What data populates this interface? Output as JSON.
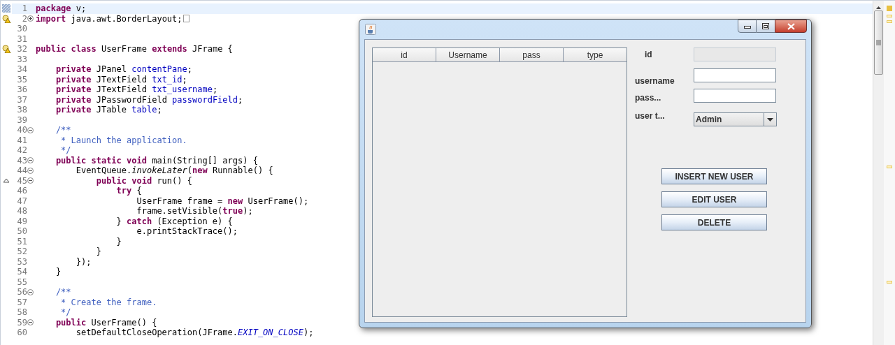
{
  "editor": {
    "lines": [
      {
        "number": "1",
        "current": true,
        "segments": [
          {
            "kind": "keyword",
            "text": "package"
          },
          {
            "kind": "plain",
            "text": " v;"
          }
        ]
      },
      {
        "number": "2",
        "warning": true,
        "fold_open": false,
        "folded_box": true,
        "segments": [
          {
            "kind": "keyword",
            "text": "import"
          },
          {
            "kind": "plain",
            "text": " java.awt.BorderLayout;"
          }
        ]
      },
      {
        "number": "30"
      },
      {
        "number": "31"
      },
      {
        "number": "32",
        "warning": true,
        "segments": [
          {
            "kind": "keyword",
            "text": "public"
          },
          {
            "kind": "keyword",
            "text": " class"
          },
          {
            "kind": "plain",
            "text": " UserFrame "
          },
          {
            "kind": "keyword",
            "text": "extends"
          },
          {
            "kind": "plain",
            "text": " JFrame {"
          }
        ]
      },
      {
        "number": "33"
      },
      {
        "number": "34",
        "segments": [
          {
            "kind": "keyword",
            "text": "    private"
          },
          {
            "kind": "plain",
            "text": " JPanel "
          },
          {
            "kind": "field",
            "text": "contentPane"
          },
          {
            "kind": "plain",
            "text": ";"
          }
        ]
      },
      {
        "number": "35",
        "segments": [
          {
            "kind": "keyword",
            "text": "    private"
          },
          {
            "kind": "plain",
            "text": " JTextField "
          },
          {
            "kind": "field",
            "text": "txt_id"
          },
          {
            "kind": "plain",
            "text": ";"
          }
        ]
      },
      {
        "number": "36",
        "segments": [
          {
            "kind": "keyword",
            "text": "    private"
          },
          {
            "kind": "plain",
            "text": " JTextField "
          },
          {
            "kind": "field",
            "text": "txt_username"
          },
          {
            "kind": "plain",
            "text": ";"
          }
        ]
      },
      {
        "number": "37",
        "segments": [
          {
            "kind": "keyword",
            "text": "    private"
          },
          {
            "kind": "plain",
            "text": " JPasswordField "
          },
          {
            "kind": "field",
            "text": "passwordField"
          },
          {
            "kind": "plain",
            "text": ";"
          }
        ]
      },
      {
        "number": "38",
        "segments": [
          {
            "kind": "keyword",
            "text": "    private"
          },
          {
            "kind": "plain",
            "text": " JTable "
          },
          {
            "kind": "field",
            "text": "table"
          },
          {
            "kind": "plain",
            "text": ";"
          }
        ]
      },
      {
        "number": "39"
      },
      {
        "number": "40",
        "fold_open": true,
        "segments": [
          {
            "kind": "comment",
            "text": "    /**"
          }
        ]
      },
      {
        "number": "41",
        "segments": [
          {
            "kind": "comment",
            "text": "     * Launch the application."
          }
        ]
      },
      {
        "number": "42",
        "segments": [
          {
            "kind": "comment",
            "text": "     */"
          }
        ]
      },
      {
        "number": "43",
        "fold_open": true,
        "segments": [
          {
            "kind": "keyword",
            "text": "    public"
          },
          {
            "kind": "keyword",
            "text": " static"
          },
          {
            "kind": "keyword",
            "text": " void"
          },
          {
            "kind": "plain",
            "text": " main(String[] args) {"
          }
        ]
      },
      {
        "number": "44",
        "fold_open": true,
        "segments": [
          {
            "kind": "plain",
            "text": "        EventQueue."
          },
          {
            "kind": "italic",
            "text": "invokeLater"
          },
          {
            "kind": "plain",
            "text": "("
          },
          {
            "kind": "keyword",
            "text": "new"
          },
          {
            "kind": "plain",
            "text": " Runnable() {"
          }
        ]
      },
      {
        "number": "45",
        "override": true,
        "fold_open": true,
        "segments": [
          {
            "kind": "keyword",
            "text": "            public"
          },
          {
            "kind": "keyword",
            "text": " void"
          },
          {
            "kind": "plain",
            "text": " run() {"
          }
        ]
      },
      {
        "number": "46",
        "segments": [
          {
            "kind": "keyword",
            "text": "                try"
          },
          {
            "kind": "plain",
            "text": " {"
          }
        ]
      },
      {
        "number": "47",
        "segments": [
          {
            "kind": "plain",
            "text": "                    UserFrame frame = "
          },
          {
            "kind": "keyword",
            "text": "new"
          },
          {
            "kind": "plain",
            "text": " UserFrame();"
          }
        ]
      },
      {
        "number": "48",
        "segments": [
          {
            "kind": "plain",
            "text": "                    frame.setVisible("
          },
          {
            "kind": "keyword",
            "text": "true"
          },
          {
            "kind": "plain",
            "text": ");"
          }
        ]
      },
      {
        "number": "49",
        "segments": [
          {
            "kind": "plain",
            "text": "                } "
          },
          {
            "kind": "keyword",
            "text": "catch"
          },
          {
            "kind": "plain",
            "text": " (Exception e) {"
          }
        ]
      },
      {
        "number": "50",
        "segments": [
          {
            "kind": "plain",
            "text": "                    e.printStackTrace();"
          }
        ]
      },
      {
        "number": "51",
        "segments": [
          {
            "kind": "plain",
            "text": "                }"
          }
        ]
      },
      {
        "number": "52",
        "segments": [
          {
            "kind": "plain",
            "text": "            }"
          }
        ]
      },
      {
        "number": "53",
        "segments": [
          {
            "kind": "plain",
            "text": "        });"
          }
        ]
      },
      {
        "number": "54",
        "segments": [
          {
            "kind": "plain",
            "text": "    }"
          }
        ]
      },
      {
        "number": "55"
      },
      {
        "number": "56",
        "fold_open": true,
        "segments": [
          {
            "kind": "comment",
            "text": "    /**"
          }
        ]
      },
      {
        "number": "57",
        "segments": [
          {
            "kind": "comment",
            "text": "     * Create the frame."
          }
        ]
      },
      {
        "number": "58",
        "segments": [
          {
            "kind": "comment",
            "text": "     */"
          }
        ]
      },
      {
        "number": "59",
        "fold_open": true,
        "segments": [
          {
            "kind": "keyword",
            "text": "    public"
          },
          {
            "kind": "plain",
            "text": " UserFrame() {"
          }
        ]
      },
      {
        "number": "60",
        "segments": [
          {
            "kind": "plain",
            "text": "        setDefaultCloseOperation(JFrame."
          },
          {
            "kind": "static",
            "text": "EXIT_ON_CLOSE"
          },
          {
            "kind": "plain",
            "text": ");"
          }
        ]
      }
    ]
  },
  "app_window": {
    "table": {
      "columns": [
        "id",
        "Username",
        "pass",
        "type"
      ]
    },
    "form": [
      {
        "kind": "text",
        "label": "id",
        "disabled": true
      },
      {
        "kind": "text",
        "label": "username",
        "disabled": false
      },
      {
        "kind": "text",
        "label": "pass...",
        "disabled": false
      },
      {
        "kind": "combo",
        "label": "user t...",
        "value": "Admin"
      }
    ],
    "buttons": [
      "INSERT NEW USER",
      "EDIT USER",
      "DELETE"
    ]
  }
}
